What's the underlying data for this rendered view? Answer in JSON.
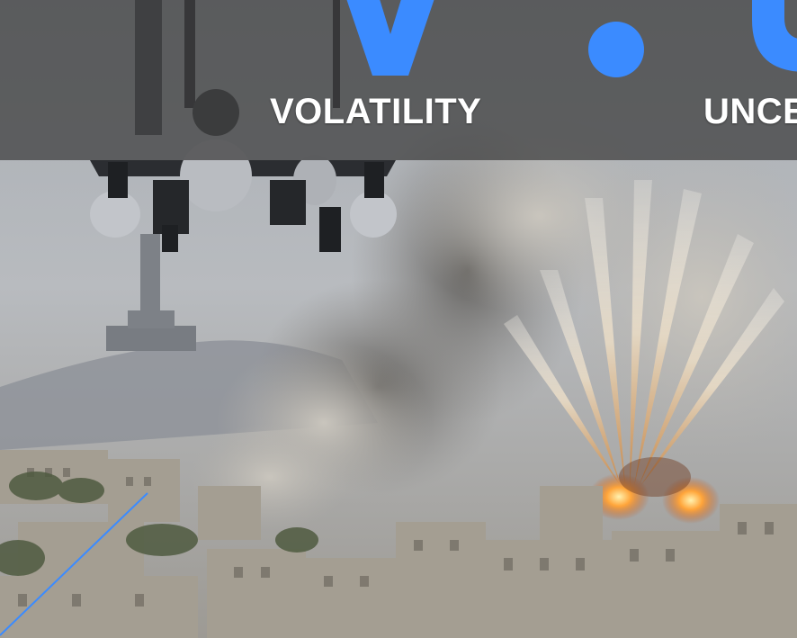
{
  "colors": {
    "accent": "#3b8bff",
    "banner": "#3c3c3c",
    "text": "#ffffff"
  },
  "banner": {
    "words": [
      "VOLATILITY",
      "UNCE"
    ]
  },
  "scene": {
    "subject": "fighter-jet-over-city-airstrike"
  }
}
